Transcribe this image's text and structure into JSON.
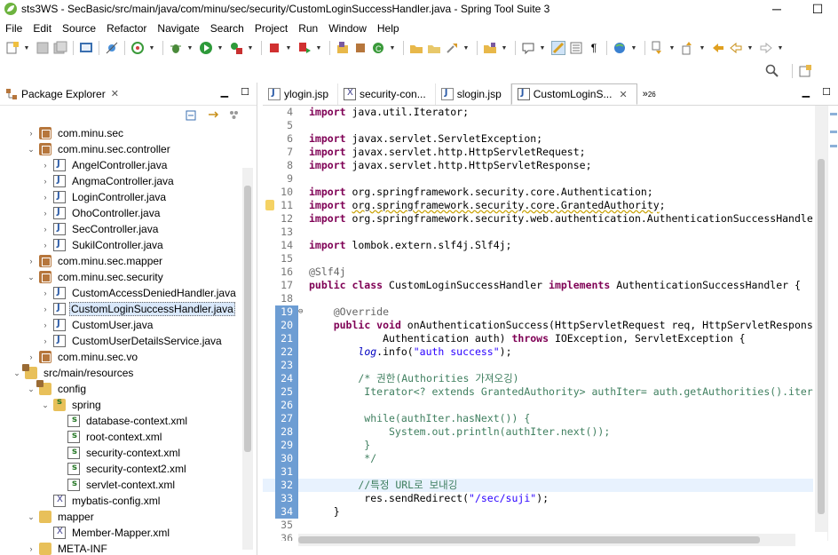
{
  "window": {
    "title": "sts3WS - SecBasic/src/main/java/com/minu/sec/security/CustomLoginSuccessHandler.java - Spring Tool Suite 3",
    "minimize": "─",
    "maximize": "☐"
  },
  "menu": [
    "File",
    "Edit",
    "Source",
    "Refactor",
    "Navigate",
    "Search",
    "Project",
    "Run",
    "Window",
    "Help"
  ],
  "package_explorer": {
    "title": "Package Explorer",
    "tree": [
      {
        "label": "com.minu.sec",
        "type": "pkg",
        "indent": 2,
        "twisty": "›"
      },
      {
        "label": "com.minu.sec.controller",
        "type": "pkg",
        "indent": 2,
        "twisty": "⌄"
      },
      {
        "label": "AngelController.java",
        "type": "java",
        "indent": 3,
        "twisty": "›"
      },
      {
        "label": "AngmaController.java",
        "type": "java",
        "indent": 3,
        "twisty": "›"
      },
      {
        "label": "LoginController.java",
        "type": "java",
        "indent": 3,
        "twisty": "›"
      },
      {
        "label": "OhoController.java",
        "type": "java",
        "indent": 3,
        "twisty": "›"
      },
      {
        "label": "SecController.java",
        "type": "java",
        "indent": 3,
        "twisty": "›"
      },
      {
        "label": "SukilController.java",
        "type": "java",
        "indent": 3,
        "twisty": "›"
      },
      {
        "label": "com.minu.sec.mapper",
        "type": "pkg",
        "indent": 2,
        "twisty": "›"
      },
      {
        "label": "com.minu.sec.security",
        "type": "pkg",
        "indent": 2,
        "twisty": "⌄"
      },
      {
        "label": "CustomAccessDeniedHandler.java",
        "type": "java",
        "indent": 3,
        "twisty": "›"
      },
      {
        "label": "CustomLoginSuccessHandler.java",
        "type": "java",
        "indent": 3,
        "twisty": "›",
        "selected": true
      },
      {
        "label": "CustomUser.java",
        "type": "java",
        "indent": 3,
        "twisty": "›"
      },
      {
        "label": "CustomUserDetailsService.java",
        "type": "java",
        "indent": 3,
        "twisty": "›"
      },
      {
        "label": "com.minu.sec.vo",
        "type": "pkg",
        "indent": 2,
        "twisty": "›"
      },
      {
        "label": "src/main/resources",
        "type": "srcfolder",
        "indent": 1,
        "twisty": "⌄"
      },
      {
        "label": "config",
        "type": "srcfolder",
        "indent": 2,
        "twisty": "⌄"
      },
      {
        "label": "spring",
        "type": "spring",
        "indent": 3,
        "twisty": "⌄"
      },
      {
        "label": "database-context.xml",
        "type": "xmls",
        "indent": 4,
        "twisty": ""
      },
      {
        "label": "root-context.xml",
        "type": "xmls",
        "indent": 4,
        "twisty": ""
      },
      {
        "label": "security-context.xml",
        "type": "xmls",
        "indent": 4,
        "twisty": ""
      },
      {
        "label": "security-context2.xml",
        "type": "xmls",
        "indent": 4,
        "twisty": ""
      },
      {
        "label": "servlet-context.xml",
        "type": "xmls",
        "indent": 4,
        "twisty": ""
      },
      {
        "label": "mybatis-config.xml",
        "type": "xml",
        "indent": 3,
        "twisty": ""
      },
      {
        "label": "mapper",
        "type": "folder",
        "indent": 2,
        "twisty": "⌄"
      },
      {
        "label": "Member-Mapper.xml",
        "type": "xml",
        "indent": 3,
        "twisty": ""
      },
      {
        "label": "META-INF",
        "type": "folder",
        "indent": 2,
        "twisty": "›"
      }
    ]
  },
  "editor": {
    "tabs": [
      {
        "label": "ylogin.jsp",
        "icon": "jsp",
        "active": false
      },
      {
        "label": "security-con...",
        "icon": "xml",
        "active": false
      },
      {
        "label": "slogin.jsp",
        "icon": "jsp",
        "active": false
      },
      {
        "label": "CustomLoginS...",
        "icon": "java",
        "active": true
      }
    ],
    "more_tabs": "»",
    "more_tabs_count": "26",
    "close_glyph": "✕",
    "lines": [
      {
        "n": "4",
        "html": "<span class=\"kw\">import</span> java.util.Iterator;"
      },
      {
        "n": "5",
        "html": ""
      },
      {
        "n": "6",
        "html": "<span class=\"kw\">import</span> javax.servlet.ServletException;"
      },
      {
        "n": "7",
        "html": "<span class=\"kw\">import</span> javax.servlet.http.HttpServletRequest;"
      },
      {
        "n": "8",
        "html": "<span class=\"kw\">import</span> javax.servlet.http.HttpServletResponse;"
      },
      {
        "n": "9",
        "html": ""
      },
      {
        "n": "10",
        "html": "<span class=\"kw\">import</span> org.springframework.security.core.Authentication;"
      },
      {
        "n": "11",
        "html": "<span class=\"kw\">import</span> <span class=\"uline\">org.springframework.security.core.GrantedAuthority</span>;",
        "warn": true
      },
      {
        "n": "12",
        "html": "<span class=\"kw\">import</span> org.springframework.security.web.authentication.AuthenticationSuccessHandler"
      },
      {
        "n": "13",
        "html": ""
      },
      {
        "n": "14",
        "html": "<span class=\"kw\">import</span> lombok.extern.slf4j.Slf4j;"
      },
      {
        "n": "15",
        "html": ""
      },
      {
        "n": "16",
        "html": "<span class=\"ann\">@Slf4j</span>"
      },
      {
        "n": "17",
        "html": "<span class=\"kw\">public class</span> CustomLoginSuccessHandler <span class=\"kw\">implements</span> AuthenticationSuccessHandler {"
      },
      {
        "n": "18",
        "html": ""
      },
      {
        "n": "19",
        "html": "    <span class=\"ann\">@Override</span>",
        "bp": true,
        "fold": "⊖"
      },
      {
        "n": "20",
        "html": "    <span class=\"kw\">public void</span> onAuthenticationSuccess(HttpServletRequest req, HttpServletResponse",
        "bp": true
      },
      {
        "n": "21",
        "html": "            Authentication auth) <span class=\"kw\">throws</span> IOException, ServletException {",
        "bp": true
      },
      {
        "n": "22",
        "html": "        <span class=\"sfield\">log</span>.info(<span class=\"str\">\"auth success\"</span>);",
        "bp": true
      },
      {
        "n": "23",
        "html": "",
        "bp": true
      },
      {
        "n": "24",
        "html": "        <span class=\"cm\">/* 권한(Authorities 가져오깅)</span>",
        "bp": true
      },
      {
        "n": "25",
        "html": "<span class=\"cm\">         Iterator&lt;? extends GrantedAuthority&gt; authIter= auth.getAuthorities().itera</span>",
        "bp": true
      },
      {
        "n": "26",
        "html": "",
        "bp": true
      },
      {
        "n": "27",
        "html": "<span class=\"cm\">         while(authIter.hasNext()) {</span>",
        "bp": true
      },
      {
        "n": "28",
        "html": "<span class=\"cm\">             System.out.println(authIter.next());</span>",
        "bp": true
      },
      {
        "n": "29",
        "html": "<span class=\"cm\">         }</span>",
        "bp": true
      },
      {
        "n": "30",
        "html": "<span class=\"cm\">         */</span>",
        "bp": true
      },
      {
        "n": "31",
        "html": "",
        "bp": true
      },
      {
        "n": "32",
        "html": "        <span class=\"cm\">//특정 URL로 보내깅</span>",
        "bp": true,
        "cur": true
      },
      {
        "n": "33",
        "html": "         res.sendRedirect(<span class=\"str\">\"/sec/suji\"</span>);",
        "bp": true
      },
      {
        "n": "34",
        "html": "    }",
        "bp": true
      },
      {
        "n": "35",
        "html": ""
      },
      {
        "n": "36",
        "html": "}"
      }
    ]
  }
}
